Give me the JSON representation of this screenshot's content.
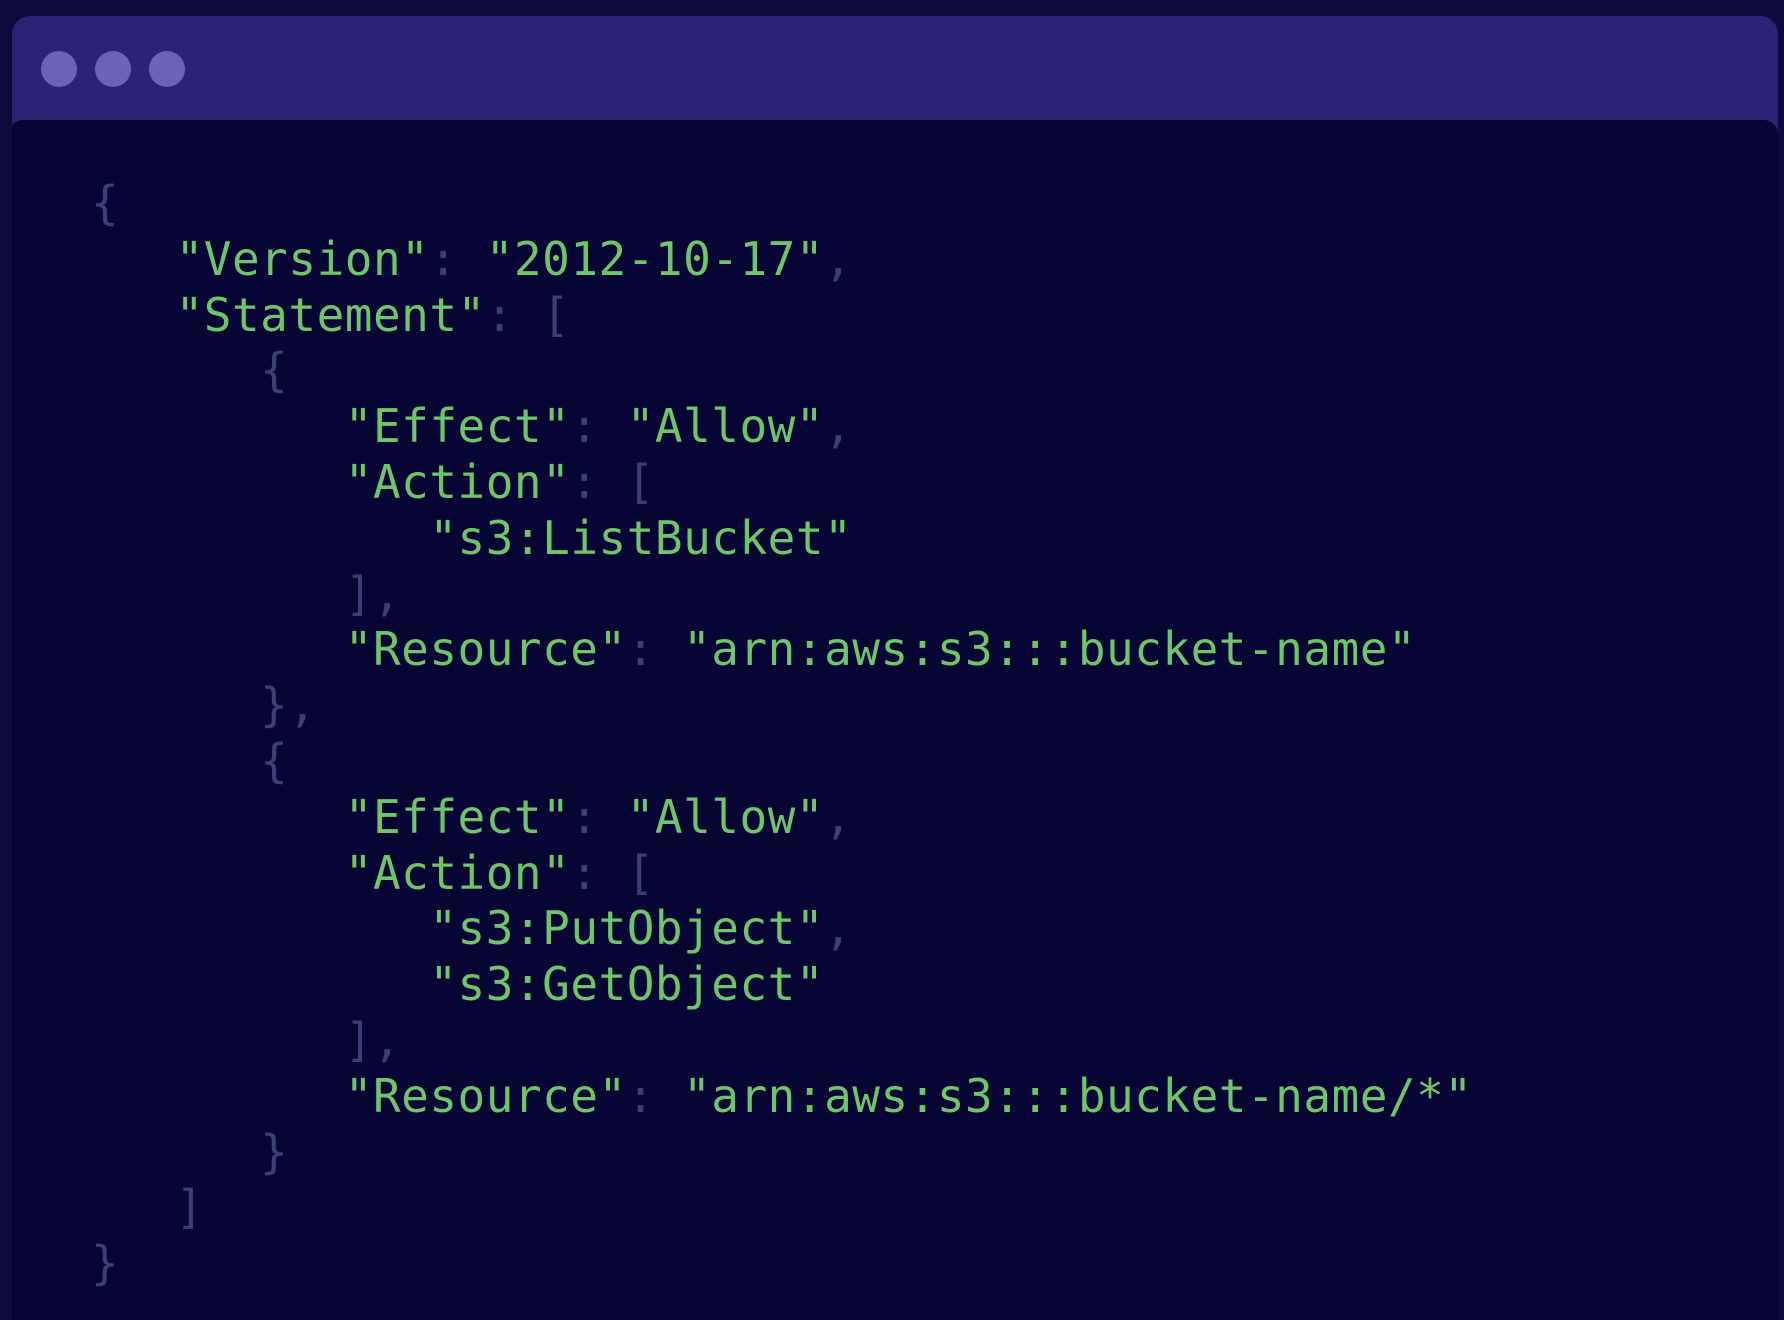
{
  "window": {
    "title_dots": [
      "close",
      "minimize",
      "maximize"
    ]
  },
  "code": {
    "lines": [
      [
        {
          "t": "{",
          "c": "p"
        }
      ],
      [
        {
          "t": "   ",
          "c": "p"
        },
        {
          "t": "\"Version\"",
          "c": "k"
        },
        {
          "t": ": ",
          "c": "p"
        },
        {
          "t": "\"2012-10-17\"",
          "c": "k"
        },
        {
          "t": ",",
          "c": "p"
        }
      ],
      [
        {
          "t": "   ",
          "c": "p"
        },
        {
          "t": "\"Statement\"",
          "c": "k"
        },
        {
          "t": ": [",
          "c": "p"
        }
      ],
      [
        {
          "t": "      {",
          "c": "p"
        }
      ],
      [
        {
          "t": "         ",
          "c": "p"
        },
        {
          "t": "\"Effect\"",
          "c": "k"
        },
        {
          "t": ": ",
          "c": "p"
        },
        {
          "t": "\"Allow\"",
          "c": "k"
        },
        {
          "t": ",",
          "c": "p"
        }
      ],
      [
        {
          "t": "         ",
          "c": "p"
        },
        {
          "t": "\"Action\"",
          "c": "k"
        },
        {
          "t": ": [",
          "c": "p"
        }
      ],
      [
        {
          "t": "            ",
          "c": "p"
        },
        {
          "t": "\"s3:ListBucket\"",
          "c": "k"
        }
      ],
      [
        {
          "t": "         ],",
          "c": "p"
        }
      ],
      [
        {
          "t": "         ",
          "c": "p"
        },
        {
          "t": "\"Resource\"",
          "c": "k"
        },
        {
          "t": ": ",
          "c": "p"
        },
        {
          "t": "\"arn:aws:s3:::bucket-name\"",
          "c": "k"
        }
      ],
      [
        {
          "t": "      },",
          "c": "p"
        }
      ],
      [
        {
          "t": "      {",
          "c": "p"
        }
      ],
      [
        {
          "t": "         ",
          "c": "p"
        },
        {
          "t": "\"Effect\"",
          "c": "k"
        },
        {
          "t": ": ",
          "c": "p"
        },
        {
          "t": "\"Allow\"",
          "c": "k"
        },
        {
          "t": ",",
          "c": "p"
        }
      ],
      [
        {
          "t": "         ",
          "c": "p"
        },
        {
          "t": "\"Action\"",
          "c": "k"
        },
        {
          "t": ": [",
          "c": "p"
        }
      ],
      [
        {
          "t": "            ",
          "c": "p"
        },
        {
          "t": "\"s3:PutObject\"",
          "c": "k"
        },
        {
          "t": ",",
          "c": "p"
        }
      ],
      [
        {
          "t": "            ",
          "c": "p"
        },
        {
          "t": "\"s3:GetObject\"",
          "c": "k"
        }
      ],
      [
        {
          "t": "         ],",
          "c": "p"
        }
      ],
      [
        {
          "t": "         ",
          "c": "p"
        },
        {
          "t": "\"Resource\"",
          "c": "k"
        },
        {
          "t": ": ",
          "c": "p"
        },
        {
          "t": "\"arn:aws:s3:::bucket-name/*\"",
          "c": "k"
        }
      ],
      [
        {
          "t": "      }",
          "c": "p"
        }
      ],
      [
        {
          "t": "   ]",
          "c": "p"
        }
      ],
      [
        {
          "t": "}",
          "c": "p"
        }
      ]
    ]
  },
  "colors": {
    "page_background": "#0f0b3d",
    "titlebar": "#2c2377",
    "window_dots": "#6a63b6",
    "editor_background": "#060533",
    "string_text": "#6fc56c",
    "punctuation": "#3a3f78"
  }
}
